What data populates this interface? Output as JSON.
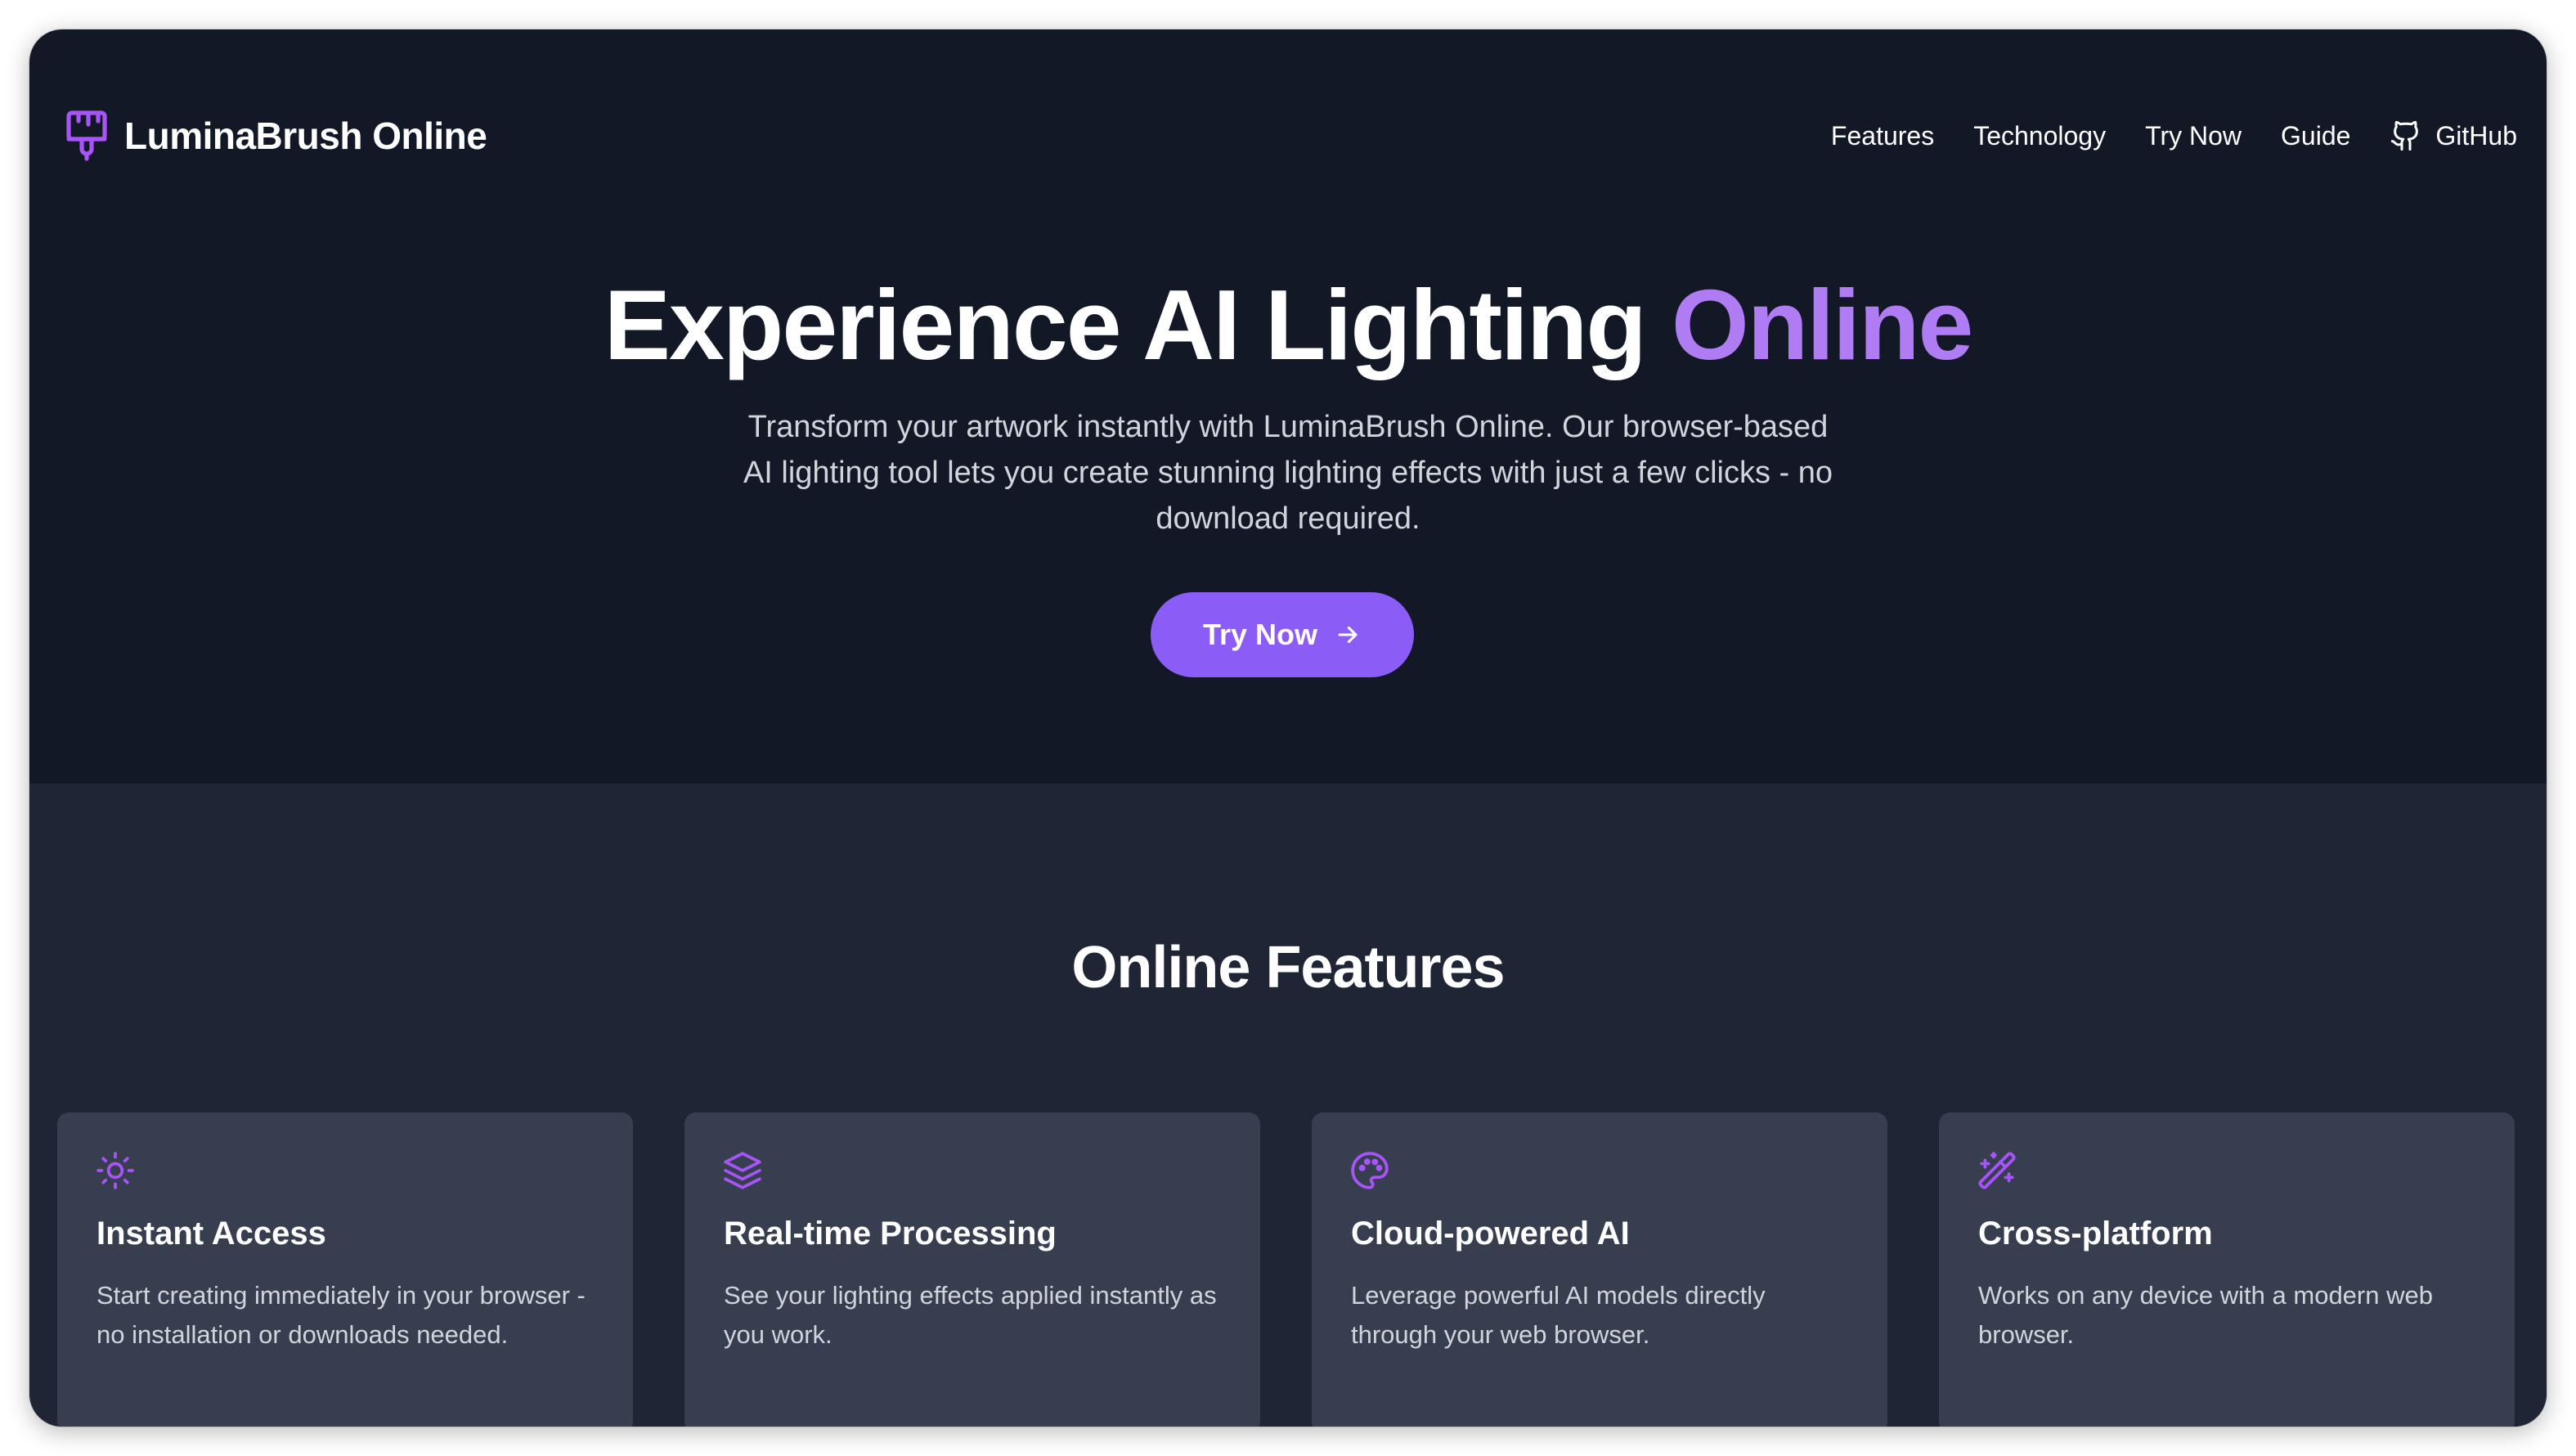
{
  "nav": {
    "brand": "LuminaBrush Online",
    "brand_icon": "paintbrush-icon",
    "links": [
      "Features",
      "Technology",
      "Try Now",
      "Guide"
    ],
    "github_label": "GitHub",
    "github_icon": "github-icon"
  },
  "hero": {
    "title_main": "Experience AI Lighting ",
    "title_accent": "Online",
    "subtitle": "Transform your artwork instantly with LuminaBrush Online. Our browser-based AI lighting tool lets you create stunning lighting effects with just a few clicks - no download required.",
    "cta_label": "Try Now",
    "cta_icon": "arrow-right-icon"
  },
  "features": {
    "title": "Online Features",
    "cards": [
      {
        "icon": "sun-icon",
        "title": "Instant Access",
        "description": "Start creating immediately in your browser - no installation or downloads needed."
      },
      {
        "icon": "layers-icon",
        "title": "Real-time Processing",
        "description": "See your lighting effects applied instantly as you work."
      },
      {
        "icon": "palette-icon",
        "title": "Cloud-powered AI",
        "description": "Leverage powerful AI models directly through your web browser."
      },
      {
        "icon": "magic-wand-icon",
        "title": "Cross-platform",
        "description": "Works on any device with a modern web browser."
      }
    ]
  },
  "colors": {
    "hero_bg": "#121826",
    "features_bg": "#1f2535",
    "card_bg": "#373e50",
    "accent": "#8b5cf6",
    "accent_text": "#b07cf3"
  }
}
